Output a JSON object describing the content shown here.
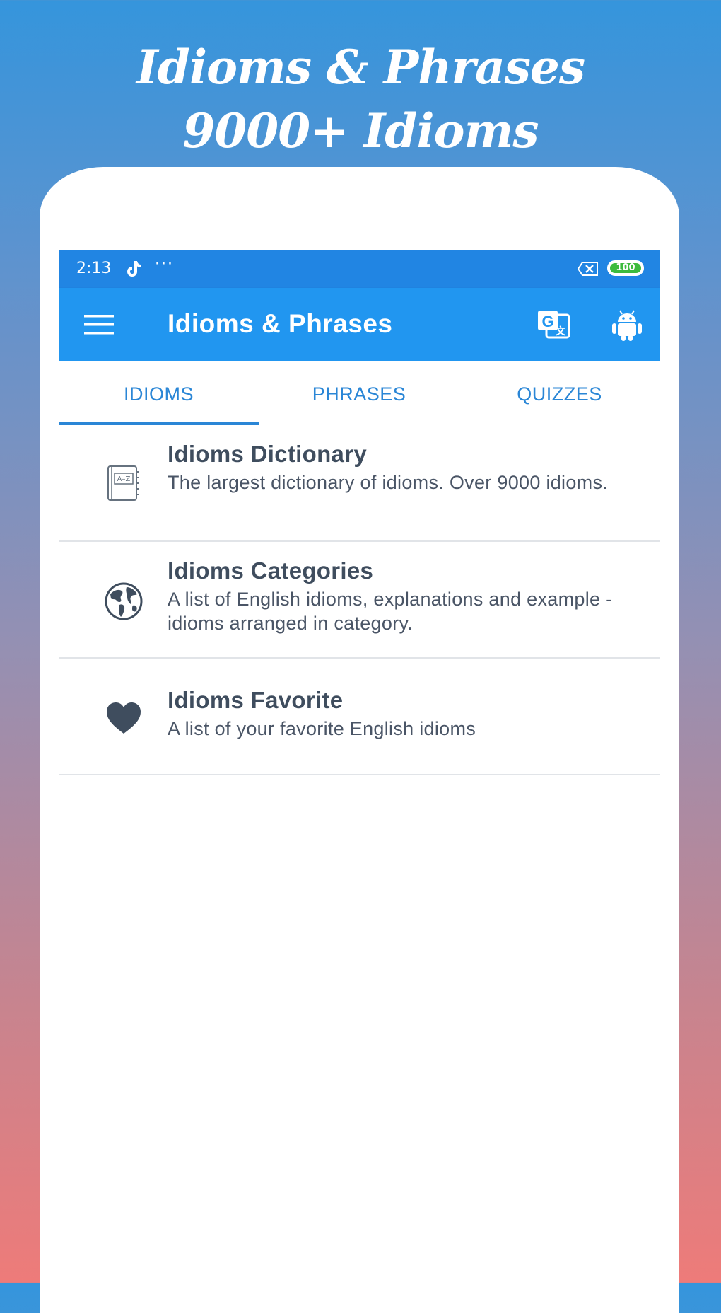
{
  "promo": {
    "line1": "Idioms & Phrases",
    "line2": "9000+ Idioms"
  },
  "status_bar": {
    "time": "2:13",
    "dots": "···",
    "battery_level": "100",
    "icons": [
      "tiktok-icon",
      "more-dots-icon",
      "sim-x-icon",
      "battery-icon"
    ]
  },
  "app_bar": {
    "title": "Idioms & Phrases",
    "icons": [
      "menu-icon",
      "translate-icon",
      "android-icon"
    ]
  },
  "tabs": [
    {
      "label": "IDIOMS",
      "selected": true
    },
    {
      "label": "PHRASES",
      "selected": false
    },
    {
      "label": "QUIZZES",
      "selected": false
    }
  ],
  "items": [
    {
      "title": "Idioms Dictionary",
      "description": "The largest dictionary of idioms. Over 9000 idioms.",
      "icon": "dictionary-book-icon"
    },
    {
      "title": "Idioms Categories",
      "description": "A list of English idioms, explanations and example - idioms arranged in category.",
      "icon": "globe-icon"
    },
    {
      "title": "Idioms Favorite",
      "description": "A list of your favorite English idioms",
      "icon": "heart-icon"
    }
  ],
  "colors": {
    "status_bar": "#2185e3",
    "app_bar": "#2196f0",
    "tab_text": "#2a86d6",
    "item_text": "#3f4d5e",
    "gradient_top": "#3595dc",
    "gradient_bottom": "#ee7b79"
  }
}
